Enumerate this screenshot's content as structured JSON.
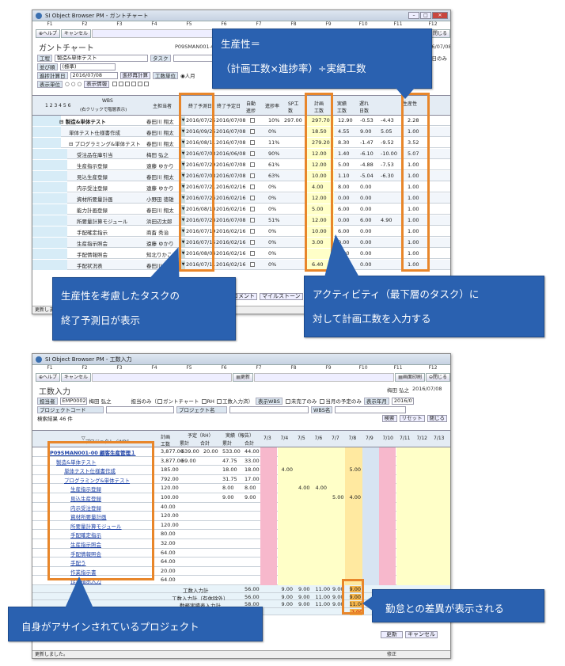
{
  "gantt": {
    "title_bar": "SI Object Browser PM - ガントチャート",
    "fkeys": [
      "F1",
      "F2",
      "F3",
      "F4",
      "F5",
      "F6",
      "F7",
      "F8",
      "F9",
      "F10",
      "F11",
      "F12"
    ],
    "buttons": {
      "help": "ヘルプ",
      "cancel": "キャンセル",
      "close": "閉じる"
    },
    "page_title": "ガントチャート",
    "project_code": "P09SMAN001-00",
    "date_right": "2016/07/08",
    "form": {
      "process_label": "工程",
      "process_value": "製造&単体テスト",
      "task_label": "タスク",
      "sort_label": "並び順",
      "sort_value": "(標準)",
      "progress_date_label": "進捗計算日",
      "progress_date_value": "2016/07/08",
      "recalc_button": "進捗再計算",
      "unit_label": "工数単位",
      "unit_value": "人月",
      "display_unit_label": "表示単位",
      "display_info_button": "表示情報",
      "hint": "(右クリックで階層表示)",
      "option_text": "営業日のみ"
    },
    "col_headers": {
      "wbs": "WBS",
      "owner": "主担当者",
      "forecast": "終了予測日",
      "planned_end": "終了予定日",
      "auto": "自動進捗",
      "rate": "進捗率",
      "sp": "SP工数",
      "plan": "計画工数",
      "actual": "実績工数",
      "delay": "遅れ日数",
      "productivity": "生産性"
    },
    "levels": "1 2 3 4 5 6",
    "rows": [
      {
        "name": "製造&単体テスト",
        "owner": "春田川 翔太",
        "forecast": "2016/07/25",
        "planned": "2016/07/08",
        "rate": "10%",
        "sp": "297.00",
        "plan": "297.70",
        "actual": "12.90",
        "delay": "-0.53",
        "e": "-4.43",
        "prod": "2.28"
      },
      {
        "name": "単体テスト仕様書作成",
        "owner": "春田川 翔太",
        "forecast": "2016/09/25",
        "planned": "2016/07/08",
        "rate": "0%",
        "sp": "",
        "plan": "18.50",
        "actual": "4.55",
        "delay": "9.00",
        "e": "5.05",
        "prod": "1.00"
      },
      {
        "name": "プログラミング&単体テスト",
        "owner": "春田川 翔太",
        "forecast": "2016/08/11",
        "planned": "2016/07/08",
        "rate": "11%",
        "sp": "",
        "plan": "279.20",
        "actual": "8.30",
        "delay": "-1.47",
        "e": "-9.52",
        "prod": "3.52"
      },
      {
        "name": "受注品在庫引当",
        "owner": "梅田 弘之",
        "forecast": "2016/07/08",
        "planned": "2016/06/08",
        "rate": "90%",
        "sp": "",
        "plan": "12.00",
        "actual": "1.40",
        "delay": "-6.10",
        "e": "-10.00",
        "prod": "5.07"
      },
      {
        "name": "生産指示登録",
        "owner": "遠藤 ゆかり",
        "forecast": "2016/07/29",
        "planned": "2016/07/08",
        "rate": "61%",
        "sp": "",
        "plan": "12.00",
        "actual": "5.00",
        "delay": "-4.88",
        "e": "-7.53",
        "prod": "1.00"
      },
      {
        "name": "見込生産登録",
        "owner": "春田川 翔太",
        "forecast": "2016/07/08",
        "planned": "2016/07/08",
        "rate": "63%",
        "sp": "",
        "plan": "10.00",
        "actual": "1.10",
        "delay": "-5.04",
        "e": "-6.30",
        "prod": "1.00"
      },
      {
        "name": "内示受注登録",
        "owner": "遠藤 ゆかり",
        "forecast": "2016/07/21",
        "planned": "2016/02/16",
        "rate": "0%",
        "sp": "",
        "plan": "4.00",
        "actual": "8.00",
        "delay": "0.00",
        "e": "",
        "prod": "1.00"
      },
      {
        "name": "資材所要量計画",
        "owner": "小野田 徳雄",
        "forecast": "2016/07/26",
        "planned": "2016/02/16",
        "rate": "0%",
        "sp": "",
        "plan": "12.00",
        "actual": "0.00",
        "delay": "0.00",
        "e": "",
        "prod": "1.00"
      },
      {
        "name": "能力計画登録",
        "owner": "春田川 翔太",
        "forecast": "2016/08/10",
        "planned": "2016/02/16",
        "rate": "0%",
        "sp": "",
        "plan": "5.00",
        "actual": "6.00",
        "delay": "0.00",
        "e": "",
        "prod": "1.00"
      },
      {
        "name": "所要量計算モジュール",
        "owner": "浜田辺太郎",
        "forecast": "2016/07/28",
        "planned": "2016/07/08",
        "rate": "51%",
        "sp": "",
        "plan": "12.00",
        "actual": "0.00",
        "delay": "6.00",
        "e": "4.90",
        "prod": "1.00"
      },
      {
        "name": "手配確定指示",
        "owner": "商畜 秀治",
        "forecast": "2016/07/19",
        "planned": "2016/02/16",
        "rate": "0%",
        "sp": "",
        "plan": "10.00",
        "actual": "6.00",
        "delay": "0.00",
        "e": "",
        "prod": "1.00"
      },
      {
        "name": "生産指示照会",
        "owner": "遠藤 ゆかり",
        "forecast": "2016/07/15",
        "planned": "2016/02/16",
        "rate": "0%",
        "sp": "",
        "plan": "3.00",
        "actual": "0.00",
        "delay": "0.00",
        "e": "",
        "prod": "1.00"
      },
      {
        "name": "手配情報照会",
        "owner": "知北りかこ",
        "forecast": "2016/08/04",
        "planned": "2016/02/16",
        "rate": "0%",
        "sp": "",
        "plan": "",
        "actual": "0.00",
        "delay": "0.00",
        "e": "",
        "prod": "1.00"
      },
      {
        "name": "手配状況表",
        "owner": "春田川 翔太",
        "forecast": "2016/07/11",
        "planned": "2016/02/16",
        "rate": "0%",
        "sp": "",
        "plan": "6.40",
        "actual": "0.00",
        "delay": "0.00",
        "e": "",
        "prod": "1.00"
      }
    ],
    "bottom_buttons": {
      "milestone": "マイルストーン",
      "comment": "コメント"
    },
    "status": "更新しました。"
  },
  "callouts": {
    "productivity_title": "生産性＝",
    "productivity_formula": "（計画工数×進捗率）÷実績工数",
    "forecast_line1": "生産性を考慮したタスクの",
    "forecast_line2": "終了予測日が表示",
    "activity_line1": "アクティビティ（最下層のタスク）に",
    "activity_line2": "対して計画工数を入力する",
    "assigned": "自身がアサインされているプロジェクト",
    "diff": "勤怠との差異が表示される"
  },
  "work": {
    "title_bar": "SI Object Browser PM - 工数入力",
    "fkeys": [
      "F1",
      "F2",
      "F3",
      "F4",
      "F5",
      "F6",
      "F7",
      "F8",
      "F9",
      "F10",
      "F11",
      "F12"
    ],
    "buttons": {
      "help": "ヘルプ",
      "cancel": "キャンセル",
      "update": "更新",
      "screen_print": "画面印刷",
      "close": "閉じる"
    },
    "page_title": "工数入力",
    "user_name": "梅田 弘之",
    "date_right": "2016/07/08",
    "form": {
      "owner_label": "担当者",
      "owner_code": "EMP0002",
      "owner_name": "梅田 弘之",
      "only_assigned": "担当のみ",
      "gantt_chart": "ガントチャート",
      "rh": "RH",
      "work_input_method": "工数入力済",
      "display_wbs_label": "表示WBS",
      "incomplete_only": "未完了のみ",
      "month_plan_only": "当月の予定のみ",
      "display_month_label": "表示年月",
      "display_month_value": "2016/07",
      "project_code_label": "プロジェクトコード",
      "project_name_label": "プロジェクト名",
      "wbs_label": "WBS名",
      "search": "検索",
      "reset": "リセット",
      "close2": "閉じる",
      "result_count": "検索結果 46 件"
    },
    "headers": {
      "project": "プロジェクト／WBS",
      "plan": "計画工数",
      "plan_rh": "予定（RH）",
      "actual_report": "実績（報告）",
      "cumulative": "累計",
      "total": "合計",
      "days": [
        "7/3",
        "7/4",
        "7/5",
        "7/6",
        "7/7",
        "7/8",
        "7/9",
        "7/10",
        "7/11",
        "7/12",
        "7/13"
      ]
    },
    "rows": [
      {
        "name": "P09SMAN001-00 顧客生産管理１",
        "plan": "3,877.00",
        "c1": "639.00",
        "c2": "20.00",
        "c3": "533.00",
        "c4": "44.00",
        "days": [
          "",
          "",
          "",
          "",
          "",
          "",
          "",
          "",
          "",
          "",
          ""
        ]
      },
      {
        "name": "製造&単体テスト",
        "plan": "3,877.00",
        "c1": "69.00",
        "c2": "",
        "c3": "47.75",
        "c4": "33.00",
        "days": [
          "",
          "",
          "",
          "",
          "",
          "",
          "",
          "",
          "",
          "",
          ""
        ]
      },
      {
        "name": "単体テスト仕様書作成",
        "plan": "185.00",
        "c1": "",
        "c2": "",
        "c3": "18.00",
        "c4": "18.00",
        "days": [
          "",
          "4.00",
          "",
          "",
          "",
          "5.00",
          "",
          "",
          "",
          "",
          ""
        ]
      },
      {
        "name": "プログラミング&単体テスト",
        "plan": "792.00",
        "c1": "",
        "c2": "",
        "c3": "31.75",
        "c4": "17.00",
        "days": [
          "",
          "",
          "",
          "",
          "",
          "",
          "",
          "",
          "",
          "",
          ""
        ]
      },
      {
        "name": "生産指示登録",
        "plan": "120.00",
        "c1": "",
        "c2": "",
        "c3": "8.00",
        "c4": "8.00",
        "days": [
          "",
          "",
          "4.00",
          "4.00",
          "",
          "",
          "",
          "",
          "",
          "",
          ""
        ]
      },
      {
        "name": "見込生産登録",
        "plan": "100.00",
        "c1": "",
        "c2": "",
        "c3": "9.00",
        "c4": "9.00",
        "days": [
          "",
          "",
          "",
          "",
          "5.00",
          "4.00",
          "",
          "",
          "",
          "",
          ""
        ]
      },
      {
        "name": "内示受注登録",
        "plan": "40.00",
        "c1": "",
        "c2": "",
        "c3": "",
        "c4": "",
        "days": [
          "",
          "",
          "",
          "",
          "",
          "",
          "",
          "",
          "",
          "",
          ""
        ]
      },
      {
        "name": "資材所要量計画",
        "plan": "120.00",
        "c1": "",
        "c2": "",
        "c3": "",
        "c4": "",
        "days": [
          "",
          "",
          "",
          "",
          "",
          "",
          "",
          "",
          "",
          "",
          ""
        ]
      },
      {
        "name": "所要量計算モジュール",
        "plan": "120.00",
        "c1": "",
        "c2": "",
        "c3": "",
        "c4": "",
        "days": [
          "",
          "",
          "",
          "",
          "",
          "",
          "",
          "",
          "",
          "",
          ""
        ]
      },
      {
        "name": "手配確定指示",
        "plan": "80.00",
        "c1": "",
        "c2": "",
        "c3": "",
        "c4": "",
        "days": [
          "",
          "",
          "",
          "",
          "",
          "",
          "",
          "",
          "",
          "",
          ""
        ]
      },
      {
        "name": "生産指示照会",
        "plan": "32.00",
        "c1": "",
        "c2": "",
        "c3": "",
        "c4": "",
        "days": [
          "",
          "",
          "",
          "",
          "",
          "",
          "",
          "",
          "",
          "",
          ""
        ]
      },
      {
        "name": "手配情報照会",
        "plan": "64.00",
        "c1": "",
        "c2": "",
        "c3": "",
        "c4": "",
        "days": [
          "",
          "",
          "",
          "",
          "",
          "",
          "",
          "",
          "",
          "",
          ""
        ]
      },
      {
        "name": "手配う",
        "plan": "64.00",
        "c1": "",
        "c2": "",
        "c3": "",
        "c4": "",
        "days": [
          "",
          "",
          "",
          "",
          "",
          "",
          "",
          "",
          "",
          "",
          ""
        ]
      },
      {
        "name": "作業指示書",
        "plan": "20.00",
        "c1": "",
        "c2": "",
        "c3": "",
        "c4": "",
        "days": [
          "",
          "",
          "",
          "",
          "",
          "",
          "",
          "",
          "",
          "",
          ""
        ]
      },
      {
        "name": "作業指示入力",
        "plan": "64.00",
        "c1": "",
        "c2": "",
        "c3": "",
        "c4": "",
        "days": [
          "",
          "",
          "",
          "",
          "",
          "",
          "",
          "",
          "",
          "",
          ""
        ]
      }
    ],
    "totals": [
      {
        "label": "工数入力計",
        "v1": "56.00",
        "days": [
          "",
          "9.00",
          "9.00",
          "11.00",
          "9.00",
          "9.00",
          "",
          "",
          "",
          "",
          ""
        ]
      },
      {
        "label": "工数入力計（有休除外）",
        "v1": "56.00",
        "days": [
          "",
          "9.00",
          "9.00",
          "11.00",
          "9.00",
          "9.00",
          "",
          "",
          "",
          "",
          ""
        ]
      },
      {
        "label": "勤務実績表入力計",
        "v1": "58.00",
        "days": [
          "",
          "9.00",
          "9.00",
          "11.00",
          "9.00",
          "11.00",
          "",
          "",
          "",
          "",
          ""
        ]
      },
      {
        "label": "差異",
        "v1": "",
        "days": [
          "",
          "",
          "",
          "",
          "",
          "-2.00",
          "",
          "",
          "",
          "",
          ""
        ]
      }
    ],
    "status": "更新しました。",
    "status_right": "修正"
  }
}
